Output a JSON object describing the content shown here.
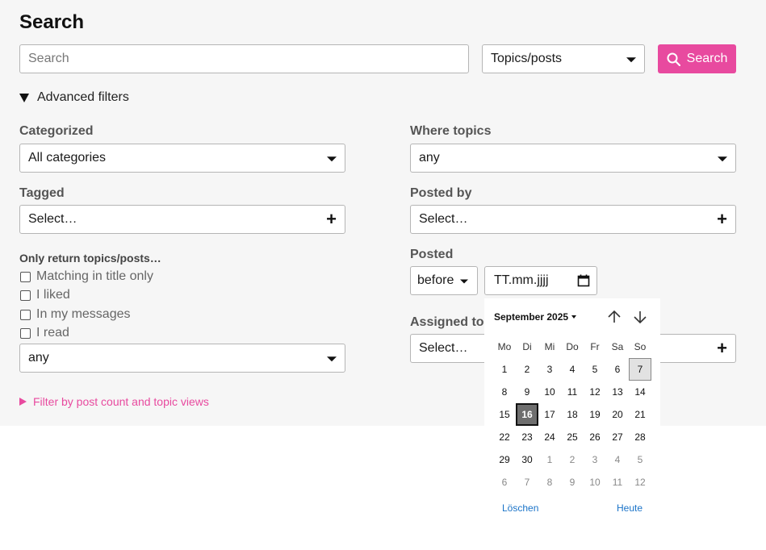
{
  "title": "Search",
  "search": {
    "placeholder": "Search",
    "type_value": "Topics/posts",
    "button_label": "Search"
  },
  "advanced": {
    "toggle_label": "Advanced filters"
  },
  "left": {
    "categorized_label": "Categorized",
    "categorized_value": "All categories",
    "tagged_label": "Tagged",
    "tagged_value": "Select…",
    "only_return_label": "Only return topics/posts…",
    "checkboxes": [
      "Matching in title only",
      "I liked",
      "In my messages",
      "I read"
    ],
    "status_value": "any",
    "filter_link": "Filter by post count and topic views"
  },
  "right": {
    "where_label": "Where topics",
    "where_value": "any",
    "posted_by_label": "Posted by",
    "posted_by_value": "Select…",
    "posted_label": "Posted",
    "posted_when": "before",
    "date_placeholder": "TT.mm.jjjj",
    "assigned_label": "Assigned to",
    "assigned_value": "Select…"
  },
  "calendar": {
    "month_label": "September 2025",
    "weekdays": [
      "Mo",
      "Di",
      "Mi",
      "Do",
      "Fr",
      "Sa",
      "So"
    ],
    "days": [
      1,
      2,
      3,
      4,
      5,
      6,
      7,
      8,
      9,
      10,
      11,
      12,
      13,
      14,
      15,
      16,
      17,
      18,
      19,
      20,
      21,
      22,
      23,
      24,
      25,
      26,
      27,
      28,
      29,
      30,
      1,
      2,
      3,
      4,
      5,
      6,
      7,
      8,
      9,
      10,
      11,
      12
    ],
    "current_month_days": 30,
    "selected_day": 7,
    "today_day": 16,
    "clear_label": "Löschen",
    "today_label": "Heute"
  },
  "colors": {
    "accent": "#e84a9f",
    "link_blue": "#1a73c8"
  }
}
